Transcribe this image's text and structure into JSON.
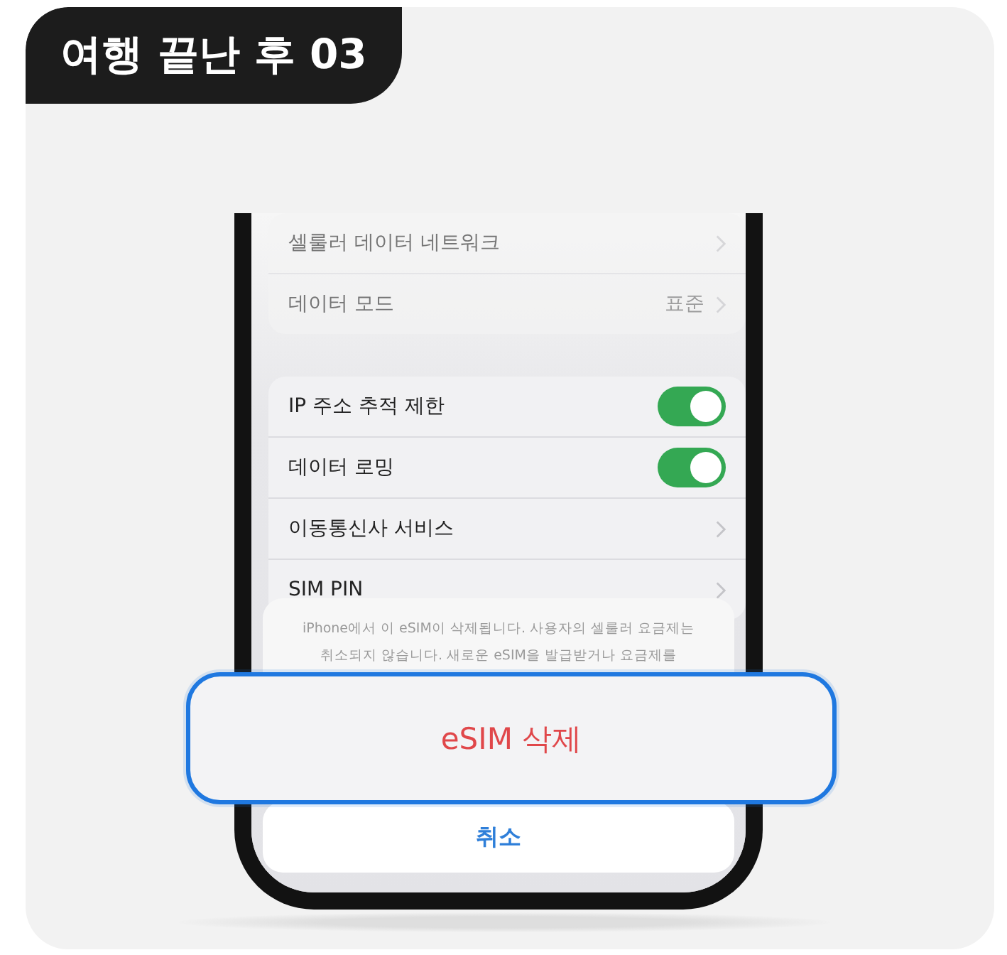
{
  "badge": "여행 끝난 후 03",
  "settings_groups": [
    {
      "faded": true,
      "rows": [
        {
          "kind": "link",
          "label": "셀룰러 데이터 네트워크"
        },
        {
          "kind": "link",
          "label": "데이터 모드",
          "value": "표준"
        }
      ]
    },
    {
      "faded": false,
      "rows": [
        {
          "kind": "toggle",
          "label": "IP 주소 추적 제한",
          "on": true
        },
        {
          "kind": "toggle",
          "label": "데이터 로밍",
          "on": true
        },
        {
          "kind": "link",
          "label": "이동통신사 서비스"
        },
        {
          "kind": "link",
          "label": "SIM PIN"
        }
      ]
    }
  ],
  "action_sheet": {
    "message": "iPhone에서 이 eSIM이 삭제됩니다. 사용자의 셀룰러 요금제는\n취소되지 않습니다. 새로운 eSIM을 발급받거나 요금제를",
    "destructive_button": "eSIM 삭제",
    "highlighted": true,
    "cancel_button": "취소"
  }
}
